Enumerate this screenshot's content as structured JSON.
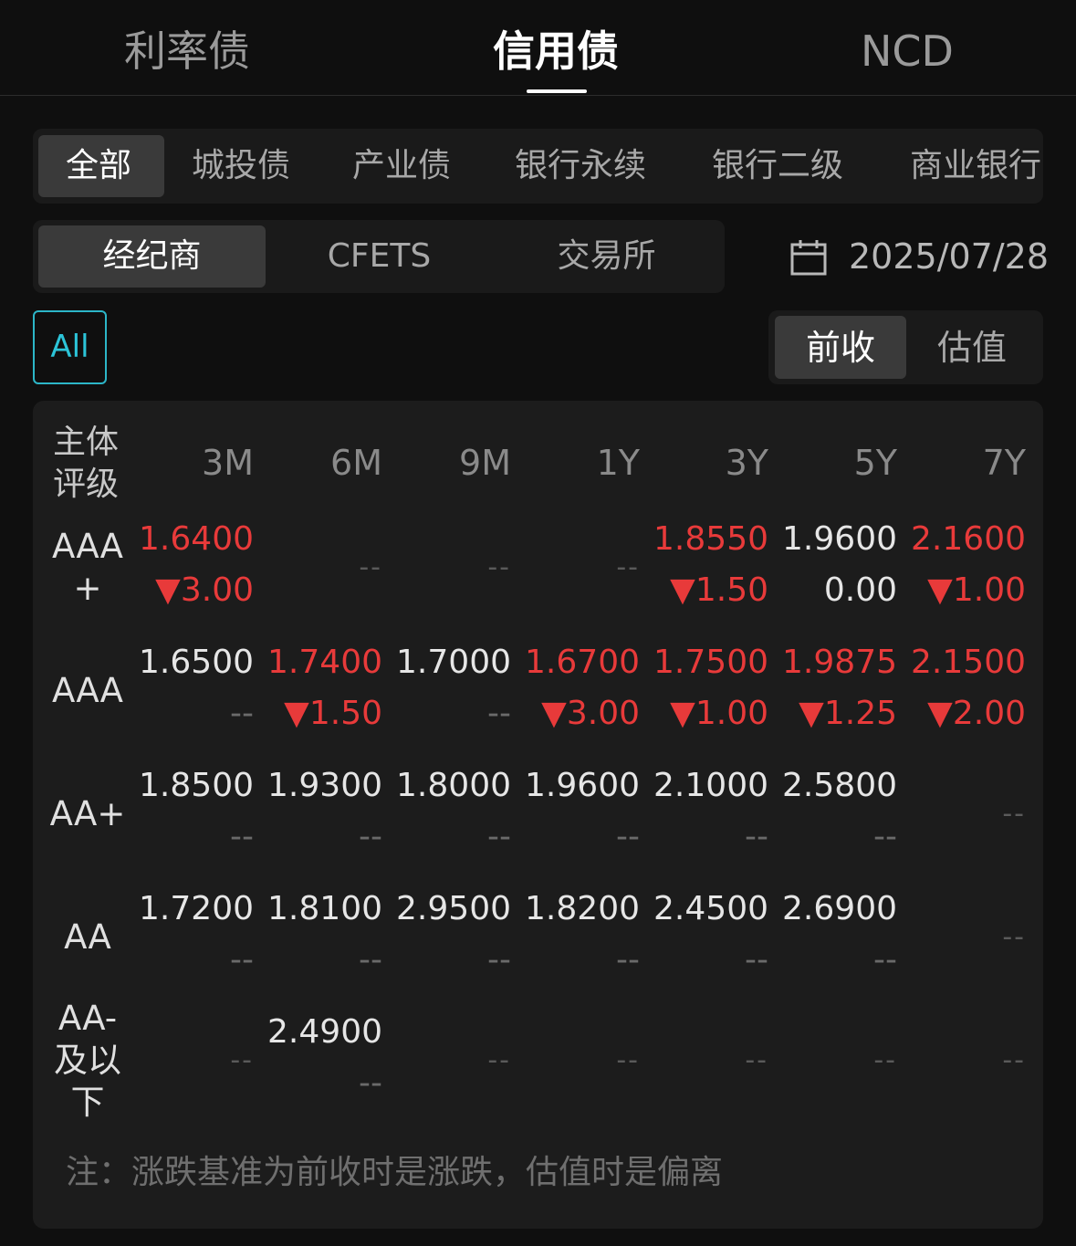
{
  "top_tabs": [
    "利率债",
    "信用债",
    "NCD"
  ],
  "categories": [
    "全部",
    "城投债",
    "产业债",
    "银行永续",
    "银行二级",
    "商业银行"
  ],
  "sources": [
    "经纪商",
    "CFETS",
    "交易所"
  ],
  "date": "2025/07/28",
  "all_label": "All",
  "modes": [
    "前收",
    "估值"
  ],
  "table": {
    "rating_header_line1": "主体",
    "rating_header_line2": "评级",
    "columns": [
      "3M",
      "6M",
      "9M",
      "1Y",
      "3Y",
      "5Y",
      "7Y"
    ],
    "rows": [
      {
        "label_line1": "AAA",
        "label_line2": "+",
        "label_line3": "",
        "cells": [
          {
            "v": "1.6400",
            "c": "▼3.00",
            "dir": "down"
          },
          {
            "v": "",
            "c": "",
            "dir": "none"
          },
          {
            "v": "",
            "c": "",
            "dir": "none"
          },
          {
            "v": "",
            "c": "",
            "dir": "none"
          },
          {
            "v": "1.8550",
            "c": "▼1.50",
            "dir": "down"
          },
          {
            "v": "1.9600",
            "c": "0.00",
            "dir": "flat"
          },
          {
            "v": "2.1600",
            "c": "▼1.00",
            "dir": "down"
          }
        ]
      },
      {
        "label_line1": "AAA",
        "label_line2": "",
        "label_line3": "",
        "cells": [
          {
            "v": "1.6500",
            "c": "--",
            "dir": "flat"
          },
          {
            "v": "1.7400",
            "c": "▼1.50",
            "dir": "down"
          },
          {
            "v": "1.7000",
            "c": "--",
            "dir": "flat"
          },
          {
            "v": "1.6700",
            "c": "▼3.00",
            "dir": "down"
          },
          {
            "v": "1.7500",
            "c": "▼1.00",
            "dir": "down"
          },
          {
            "v": "1.9875",
            "c": "▼1.25",
            "dir": "down"
          },
          {
            "v": "2.1500",
            "c": "▼2.00",
            "dir": "down"
          }
        ]
      },
      {
        "label_line1": "AA+",
        "label_line2": "",
        "label_line3": "",
        "cells": [
          {
            "v": "1.8500",
            "c": "--",
            "dir": "flat"
          },
          {
            "v": "1.9300",
            "c": "--",
            "dir": "flat"
          },
          {
            "v": "1.8000",
            "c": "--",
            "dir": "flat"
          },
          {
            "v": "1.9600",
            "c": "--",
            "dir": "flat"
          },
          {
            "v": "2.1000",
            "c": "--",
            "dir": "flat"
          },
          {
            "v": "2.5800",
            "c": "--",
            "dir": "flat"
          },
          {
            "v": "",
            "c": "",
            "dir": "none"
          }
        ]
      },
      {
        "label_line1": "AA",
        "label_line2": "",
        "label_line3": "",
        "cells": [
          {
            "v": "1.7200",
            "c": "--",
            "dir": "flat"
          },
          {
            "v": "1.8100",
            "c": "--",
            "dir": "flat"
          },
          {
            "v": "2.9500",
            "c": "--",
            "dir": "flat"
          },
          {
            "v": "1.8200",
            "c": "--",
            "dir": "flat"
          },
          {
            "v": "2.4500",
            "c": "--",
            "dir": "flat"
          },
          {
            "v": "2.6900",
            "c": "--",
            "dir": "flat"
          },
          {
            "v": "",
            "c": "",
            "dir": "none"
          }
        ]
      },
      {
        "label_line1": "AA-",
        "label_line2": "及以",
        "label_line3": "下",
        "cells": [
          {
            "v": "",
            "c": "",
            "dir": "none"
          },
          {
            "v": "2.4900",
            "c": "--",
            "dir": "flat"
          },
          {
            "v": "",
            "c": "",
            "dir": "none"
          },
          {
            "v": "",
            "c": "",
            "dir": "none"
          },
          {
            "v": "",
            "c": "",
            "dir": "none"
          },
          {
            "v": "",
            "c": "",
            "dir": "none"
          },
          {
            "v": "",
            "c": "",
            "dir": "none"
          }
        ]
      }
    ],
    "empty_placeholder": "--"
  },
  "note": "注：涨跌基准为前收时是涨跌，估值时是偏离",
  "colors": {
    "up_down_red": "#e83a3a",
    "accent_cyan": "#2cc4d8"
  }
}
